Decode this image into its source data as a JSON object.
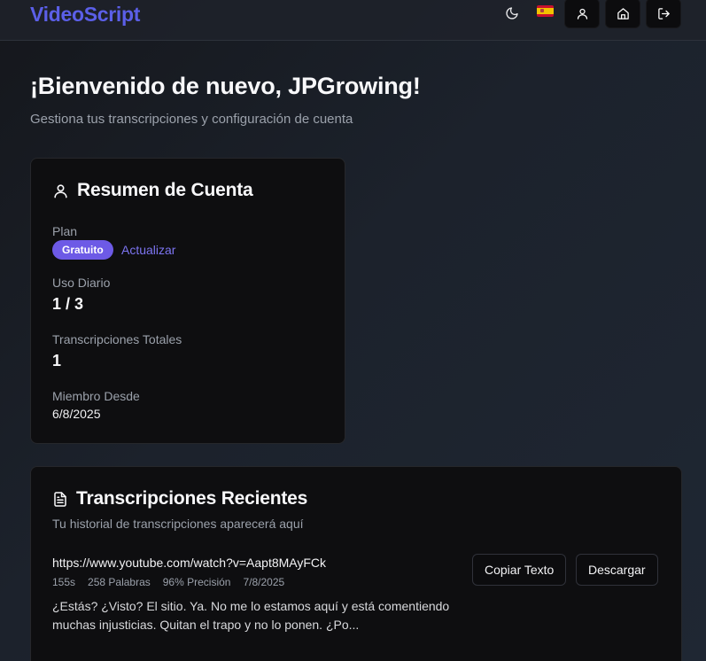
{
  "header": {
    "brand": "VideoScript",
    "icons": [
      "moon-icon",
      "spain-flag-icon",
      "user-icon",
      "home-icon",
      "logout-icon"
    ]
  },
  "welcome": {
    "title": "¡Bienvenido de nuevo, JPGrowing!",
    "subtitle": "Gestiona tus transcripciones y configuración de cuenta"
  },
  "account": {
    "title": "Resumen de Cuenta",
    "plan_label": "Plan",
    "plan_badge": "Gratuito",
    "upgrade_link": "Actualizar",
    "daily_usage_label": "Uso Diario",
    "daily_usage_value": "1 / 3",
    "total_label": "Transcripciones Totales",
    "total_value": "1",
    "member_since_label": "Miembro Desde",
    "member_since_value": "6/8/2025"
  },
  "recent": {
    "title": "Transcripciones Recientes",
    "subtitle": "Tu historial de transcripciones aparecerá aquí",
    "items": [
      {
        "url": "https://www.youtube.com/watch?v=Aapt8MAyFCk",
        "duration": "155s",
        "words": "258 Palabras",
        "accuracy": "96% Precisión",
        "date": "7/8/2025",
        "excerpt": "¿Estás? ¿Visto? El sitio. Ya. No me lo estamos aquí y está comentiendo muchas injusticias. Quitan el trapo y no lo ponen. ¿Po...",
        "copy_label": "Copiar Texto",
        "download_label": "Descargar"
      }
    ]
  },
  "colors": {
    "brand": "#5b5fe8",
    "badge": "#6d5ae6",
    "link": "#7c74f0",
    "card_bg": "#0e0e10"
  }
}
